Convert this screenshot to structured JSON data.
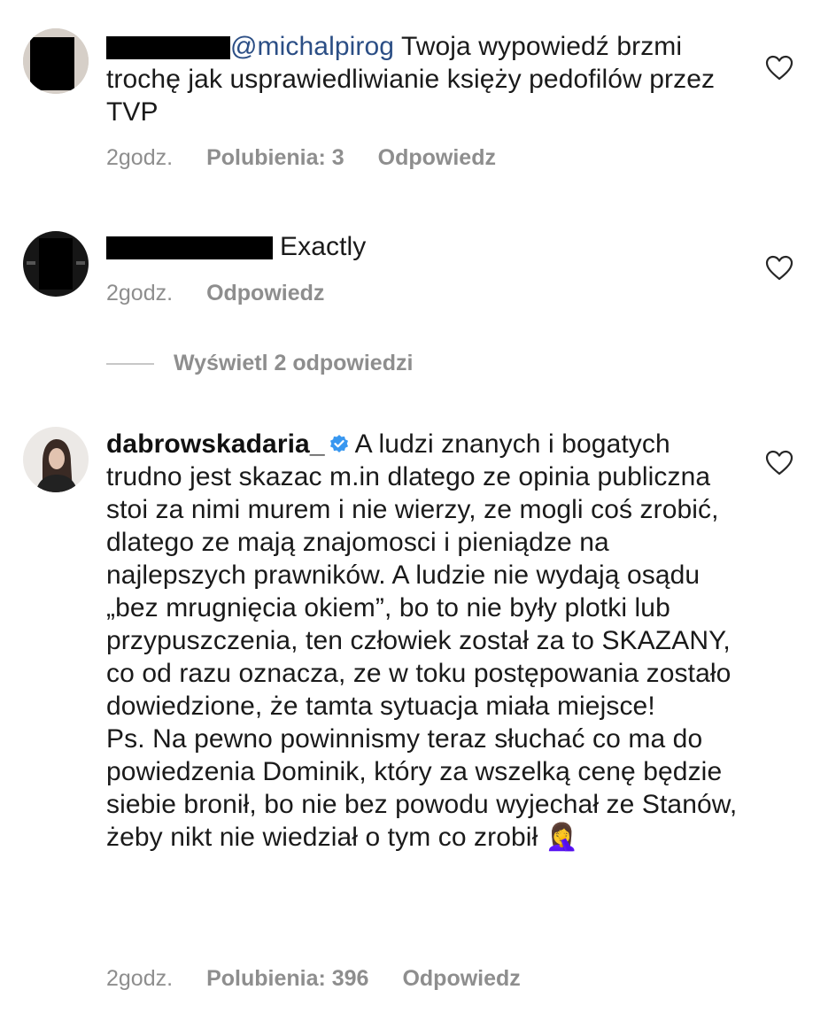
{
  "comments": [
    {
      "text": "@michalpirog Twoja wypowiedź brzmi trochę jak usprawiedliwianie księży pedofilów przez TVP",
      "mention": "@michalpirog",
      "text_rest": " Twoja wypowiedź brzmi trochę jak usprawiedliwianie księży pedofilów przez TVP",
      "time": "2godz.",
      "likes": "Polubienia: 3",
      "reply": "Odpowiedz"
    },
    {
      "text_rest": "Exactly",
      "time": "2godz.",
      "reply": "Odpowiedz",
      "view_replies": "Wyświetl 2 odpowiedzi"
    },
    {
      "username": "dabrowskadaria_",
      "verified": true,
      "paragraph1": "A ludzi znanych i bogatych trudno jest skazac m.in dlatego ze opinia publiczna stoi za nimi murem i nie wierzy, ze mogli coś zrobić, dlatego ze mają znajomosci i pieniądze na najlepszych prawników. A ludzie nie wydają osądu „bez mrugnięcia okiem”, bo to nie były plotki lub przypuszczenia, ten człowiek został za to SKAZANY, co od razu oznacza, ze w toku postępowania zostało dowiedzione, że tamta sytuacja miała miejsce!",
      "paragraph2": "Ps. Na pewno powinnismy teraz słuchać co ma do powiedzenia Dominik, który za wszelką cenę będzie siebie bronił, bo nie bez powodu wyjechał ze Stanów, żeby nikt nie wiedział o tym co zrobił",
      "emoji": "🤦‍♀️",
      "time": "2godz.",
      "likes": "Polubienia: 396",
      "reply": "Odpowiedz"
    }
  ],
  "colors": {
    "meta": "#8e8e8e",
    "mention": "#2b4e85",
    "verified": "#3897f0"
  },
  "icons": {
    "like": "heart-outline-icon",
    "verified": "verified-badge-icon"
  }
}
